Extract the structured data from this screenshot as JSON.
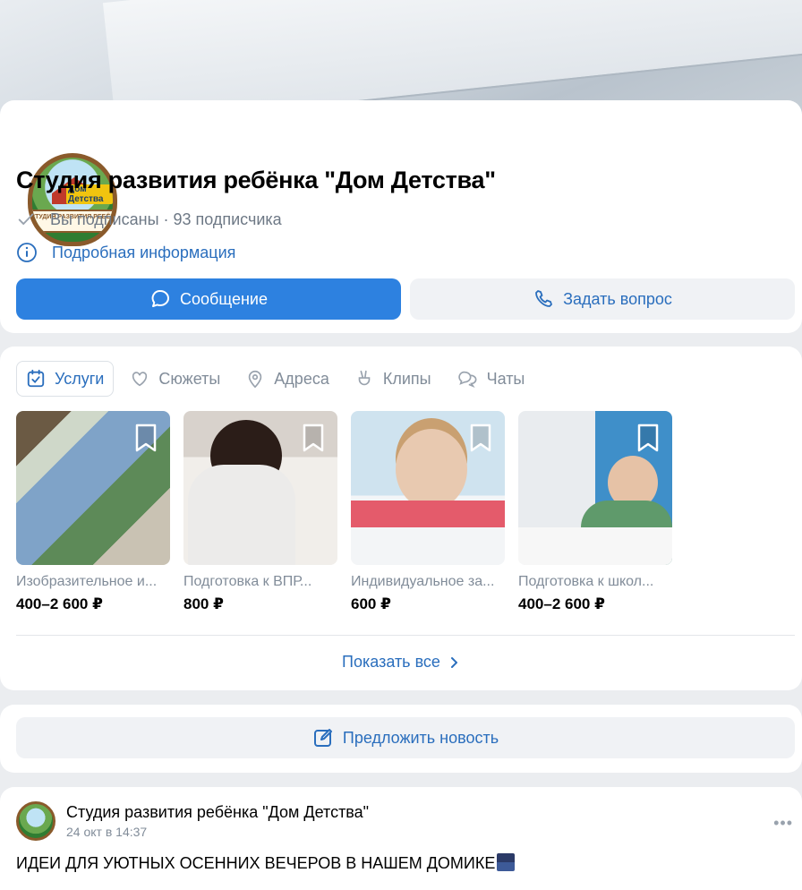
{
  "profile": {
    "logo_word": "Дом Детства",
    "logo_ribbon": "СТУДИЯ РАЗВИТИЯ РЕБЁНКА",
    "title": "Студия развития ребёнка \"Дом Детства\"",
    "subscription": "Вы подписаны · 93 подписчика",
    "details": "Подробная информация",
    "message_btn": "Сообщение",
    "ask_btn": "Задать вопрос"
  },
  "tabs": [
    {
      "label": "Услуги",
      "icon": "calendar-check-icon",
      "active": true
    },
    {
      "label": "Сюжеты",
      "icon": "stories-icon",
      "active": false
    },
    {
      "label": "Адреса",
      "icon": "location-pin-icon",
      "active": false
    },
    {
      "label": "Клипы",
      "icon": "clips-icon",
      "active": false
    },
    {
      "label": "Чаты",
      "icon": "chats-icon",
      "active": false
    }
  ],
  "services": [
    {
      "name": "Изобразительное и...",
      "price": "400–2 600 ₽"
    },
    {
      "name": "Подготовка к ВПР...",
      "price": "800 ₽"
    },
    {
      "name": "Индивидуальное за...",
      "price": "600 ₽"
    },
    {
      "name": "Подготовка к школ...",
      "price": "400–2 600 ₽"
    }
  ],
  "show_all": "Показать все",
  "suggest": "Предложить новость",
  "post": {
    "author": "Студия развития ребёнка \"Дом Детства\"",
    "date": "24 окт в 14:37",
    "text": "ИДЕИ ДЛЯ УЮТНЫХ ОСЕННИХ ВЕЧЕРОВ В НАШЕМ ДОМИКЕ",
    "more": "•••"
  },
  "colors": {
    "accent": "#2d81e0",
    "link": "#2a6ebd",
    "muted": "#818c99",
    "background": "#ebedf0"
  }
}
